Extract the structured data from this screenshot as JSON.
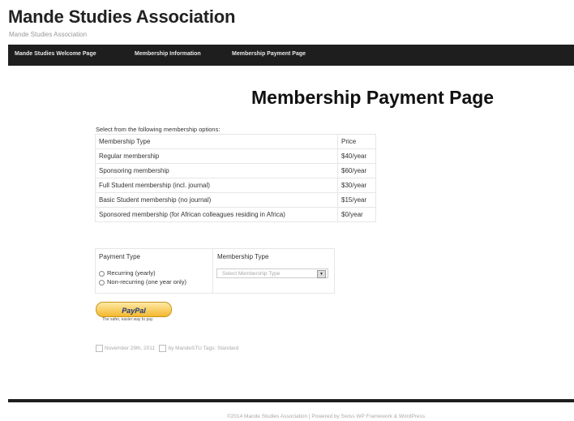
{
  "site": {
    "title": "Mande Studies Association",
    "tagline": "Mande Studies Association"
  },
  "nav": {
    "items": [
      {
        "label": "Mande Studies Welcome Page"
      },
      {
        "label": "Membership Information"
      },
      {
        "label": "Membership Payment Page"
      }
    ]
  },
  "page": {
    "title": "Membership Payment Page",
    "intro": "Select from the following membership options:"
  },
  "options_table": {
    "headers": {
      "type": "Membership Type",
      "price": "Price"
    },
    "rows": [
      {
        "type": "Regular membership",
        "price": "$40/year"
      },
      {
        "type": "Sponsoring membership",
        "price": "$60/year"
      },
      {
        "type": "Full Student membership (incl. journal)",
        "price": "$30/year"
      },
      {
        "type": "Basic Student membership (no journal)",
        "price": "$15/year"
      },
      {
        "type": "Sponsored membership (for African colleagues residing in Africa)",
        "price": "$0/year"
      }
    ]
  },
  "payment_form": {
    "payment_type_label": "Payment Type",
    "membership_type_label": "Membership Type",
    "options": [
      {
        "label": "Recurring (yearly)"
      },
      {
        "label": "Non-recurring (one year only)"
      }
    ],
    "select_placeholder": "Select Membership Type"
  },
  "paypal": {
    "button_label": "PayPal",
    "tagline": "The safer, easier way to pay"
  },
  "post_meta": {
    "date": "November 29th, 2011",
    "author": "by MandeSTU Tags: Standard"
  },
  "footer": {
    "text": "©2014 Mande Studies Association | Powered by Swiss WP Framework & WordPress"
  },
  "colors": {
    "navbar": "#1e1e1e",
    "paypal_button": "#f5b82e",
    "paypal_text": "#1e3a7b"
  }
}
